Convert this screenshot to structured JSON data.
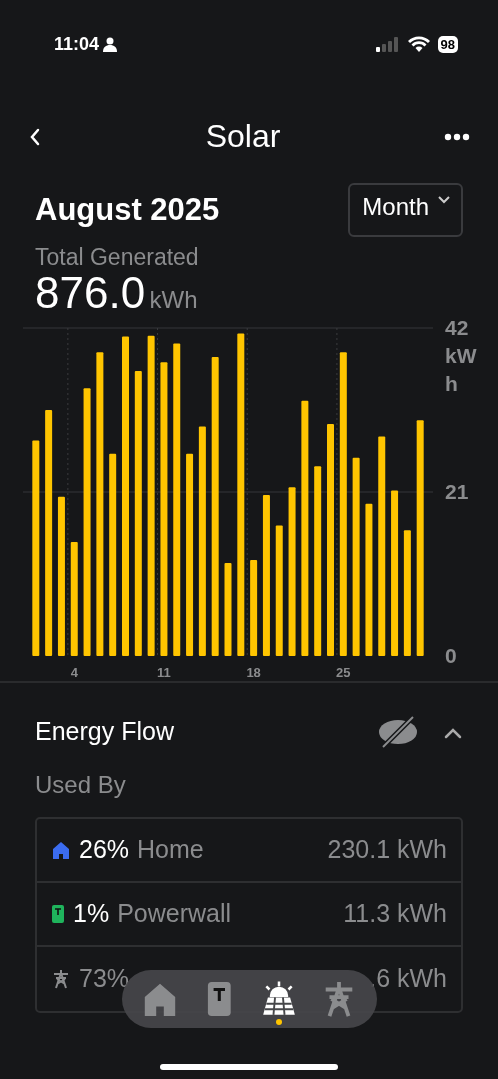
{
  "status_bar": {
    "time": "11:04",
    "battery": "98"
  },
  "nav": {
    "title": "Solar"
  },
  "period": {
    "title": "August 2025",
    "selector": "Month"
  },
  "total": {
    "label": "Total Generated",
    "value": "876.0",
    "unit": "kWh"
  },
  "chart": {
    "chart_data": {
      "type": "bar",
      "ylabel": "kWh",
      "x": [
        1,
        2,
        3,
        4,
        5,
        6,
        7,
        8,
        9,
        10,
        11,
        12,
        13,
        14,
        15,
        16,
        17,
        18,
        19,
        20,
        21,
        22,
        23,
        24,
        25,
        26,
        27,
        28,
        29,
        30,
        31
      ],
      "series": [
        {
          "color": "#ffc500",
          "values": [
            27.6,
            31.5,
            20.4,
            14.6,
            34.3,
            38.9,
            25.9,
            40.9,
            36.5,
            41.0,
            37.6,
            40.0,
            25.9,
            29.4,
            38.3,
            11.9,
            41.3,
            12.3,
            20.6,
            16.7,
            21.6,
            32.7,
            24.3,
            29.7,
            38.9,
            25.4,
            19.5,
            28.1,
            21.2,
            16.1,
            30.2
          ]
        }
      ],
      "xlim": [
        0,
        32
      ],
      "ylim": [
        0,
        42
      ],
      "yticks": [
        0,
        21,
        42
      ],
      "xticks": [
        4,
        11,
        18,
        25
      ]
    }
  },
  "energy_flow": {
    "title": "Energy Flow",
    "subtitle": "Used By",
    "rows": [
      {
        "kind": "home",
        "percent": "26%",
        "name": "Home",
        "amount": "230.1 kWh"
      },
      {
        "kind": "powerwall",
        "percent": "1%",
        "name": "Powerwall",
        "amount": "11.3 kWh"
      },
      {
        "kind": "grid",
        "percent": "73%",
        "amount": ".6 kWh"
      }
    ]
  },
  "dock": [
    {
      "kind": "home",
      "selected": false
    },
    {
      "kind": "powerwall",
      "selected": false
    },
    {
      "kind": "solar",
      "selected": true
    },
    {
      "kind": "grid",
      "selected": false
    }
  ]
}
